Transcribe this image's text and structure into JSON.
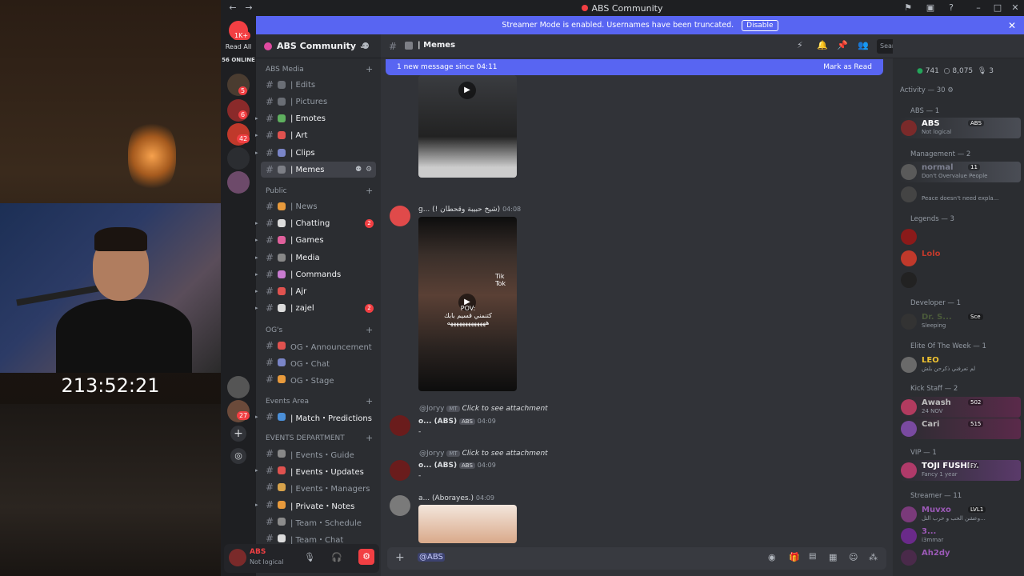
{
  "window": {
    "title": "ABS Community"
  },
  "stream": {
    "timer": "213:52:21"
  },
  "rail": {
    "read_all": "Read All",
    "online": "56 ONLINE",
    "app_badge": "1K+",
    "badges": [
      "5",
      "6",
      "42",
      "27"
    ]
  },
  "banner": {
    "text": "Streamer Mode is enabled. Usernames have been truncated.",
    "disable": "Disable"
  },
  "sidebar": {
    "server_name": "ABS Community",
    "categories": [
      {
        "label": "ABS Media"
      },
      {
        "label": "Public"
      },
      {
        "label": "OG's"
      },
      {
        "label": "Events Area"
      },
      {
        "label": "EVENTS DEPARTMENT"
      }
    ],
    "channels": [
      {
        "label": "| Edits",
        "color": "#6a6e75"
      },
      {
        "label": "| Pictures",
        "color": "#6a6e75"
      },
      {
        "label": "| Emotes",
        "color": "#5fb05f"
      },
      {
        "label": "| Art",
        "color": "#e0524f"
      },
      {
        "label": "| Clips",
        "color": "#7a85c8"
      },
      {
        "label": "| Memes",
        "color": "#7d7f86"
      },
      {
        "label": "| News",
        "color": "#e89a3c"
      },
      {
        "label": "| Chatting",
        "color": "#dcdcdc",
        "ping": "2"
      },
      {
        "label": "| Games",
        "color": "#e0609c"
      },
      {
        "label": "| Media",
        "color": "#888"
      },
      {
        "label": "| Commands",
        "color": "#c97bd0"
      },
      {
        "label": "| Ajr",
        "color": "#e0524f"
      },
      {
        "label": "| zajel",
        "color": "#dcdcdc",
        "ping": "2"
      },
      {
        "label": "OG・Announcement",
        "color": "#e0524f"
      },
      {
        "label": "OG・Chat",
        "color": "#7a85c8"
      },
      {
        "label": "OG・Stage",
        "color": "#e89a3c"
      },
      {
        "label": "| Match・Predictions",
        "color": "#4b8fd8"
      },
      {
        "label": "| Events・Guide",
        "color": "#888"
      },
      {
        "label": "| Events・Updates",
        "color": "#e0524f"
      },
      {
        "label": "| Events・Managers",
        "color": "#d8a34b"
      },
      {
        "label": "| Private・Notes",
        "color": "#e89a3c"
      },
      {
        "label": "| Team・Schedule",
        "color": "#8c8c8c"
      },
      {
        "label": "| Team・Chat",
        "color": "#dcdcdc"
      }
    ],
    "user": {
      "name": "ABS",
      "status": "Not logical"
    }
  },
  "chat": {
    "channel": "Memes",
    "search_placeholder": "Search ABS Community",
    "new_messages": "1 new message since 04:11",
    "mark_read": "Mark as Read",
    "messages": [
      {
        "author": "g... (! شيخ حبيبة وقحطان)",
        "time": "04:08"
      },
      {
        "reply_to": "@Joryy",
        "reply_tag": "MT",
        "reply_text": "Click to see attachment",
        "author": "o... (ABS)",
        "tag": "ABS",
        "time": "04:09",
        "text": "-"
      },
      {
        "reply_to": "@Joryy",
        "reply_tag": "MT",
        "reply_text": "Click to see attachment",
        "author": "o... (ABS)",
        "tag": "ABS",
        "time": "04:09",
        "text": "-"
      },
      {
        "author": "a... (Aborayes.)",
        "time": "04:09"
      }
    ],
    "video_caption": "POV:\nكتنمني قسيم بابك\nهههههههههههههه",
    "tiktok": "Tik\nTok",
    "composer_text": "@ABS"
  },
  "members": {
    "online_count": "741",
    "total_count": "8,075",
    "voice_count": "3",
    "activity": "Activity — 30",
    "groups": [
      {
        "role": "ABS — 1",
        "members": [
          {
            "name": "ABS",
            "tag": "ABS",
            "status": "Not logical",
            "color": "#ffffff"
          }
        ]
      },
      {
        "role": "Management — 2",
        "members": [
          {
            "name": "normal",
            "tag": "11",
            "status": "Don't Overvalue People",
            "color": "#7d8090"
          },
          {
            "name": "",
            "status": "Peace doesn't need expla...",
            "color": "#7d8090"
          }
        ]
      },
      {
        "role": "Legends — 3",
        "members": [
          {
            "name": "",
            "status": "",
            "color": "#9b4a4a"
          },
          {
            "name": "Lolo",
            "status": "",
            "color": "#c0392b"
          },
          {
            "name": "",
            "status": "",
            "color": "#777"
          }
        ]
      },
      {
        "role": "Developer — 1",
        "members": [
          {
            "name": "Dr. S...",
            "tag": "Sce",
            "status": "Sleeping",
            "color": "#4a5a3a"
          }
        ]
      },
      {
        "role": "Elite Of The Week — 1",
        "members": [
          {
            "name": "LEO",
            "status": "لم تعرفني ذكرحن بلش",
            "color": "#f0c330"
          }
        ]
      },
      {
        "role": "Kick Staff — 2",
        "members": [
          {
            "name": "Awash",
            "tag": "502",
            "status": "24 NOV",
            "color": "#bdbdbd"
          },
          {
            "name": "Cari",
            "tag": "515",
            "status": "",
            "color": "#bdbdbd"
          }
        ]
      },
      {
        "role": "VIP — 1",
        "members": [
          {
            "name": "TOJI FUSHI...",
            "tag": "FY",
            "status": "Fancy 1 year",
            "color": "#ffffff"
          }
        ]
      },
      {
        "role": "Streamer — 11",
        "members": [
          {
            "name": "Muvxo",
            "tag": "LVL1",
            "status": "وعشن الحب و حرب التل...",
            "color": "#9b59b6"
          },
          {
            "name": "3...",
            "status": "i3mmar",
            "color": "#9b59b6"
          },
          {
            "name": "Ah2dy",
            "status": "",
            "color": "#9b59b6"
          }
        ]
      }
    ]
  }
}
